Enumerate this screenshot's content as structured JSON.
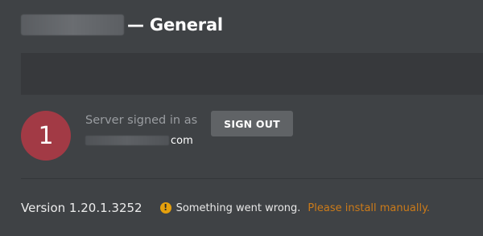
{
  "header": {
    "title_suffix": "— General"
  },
  "account": {
    "avatar_text": "1",
    "signed_in_label": "Server signed in as",
    "email_visible_suffix": "com",
    "sign_out_label": "SIGN OUT"
  },
  "status": {
    "version_text": "Version 1.20.1.3252",
    "warning_icon_glyph": "!",
    "error_message": "Something went wrong.",
    "install_link_label": "Please install manually."
  },
  "colors": {
    "background": "#3f4245",
    "banner": "#37393c",
    "avatar": "#a23a45",
    "button": "#606366",
    "warning": "#e5a00d",
    "link": "#cc7b19",
    "muted_text": "#9a9da1"
  },
  "icons": {
    "warning": "warning-icon"
  }
}
